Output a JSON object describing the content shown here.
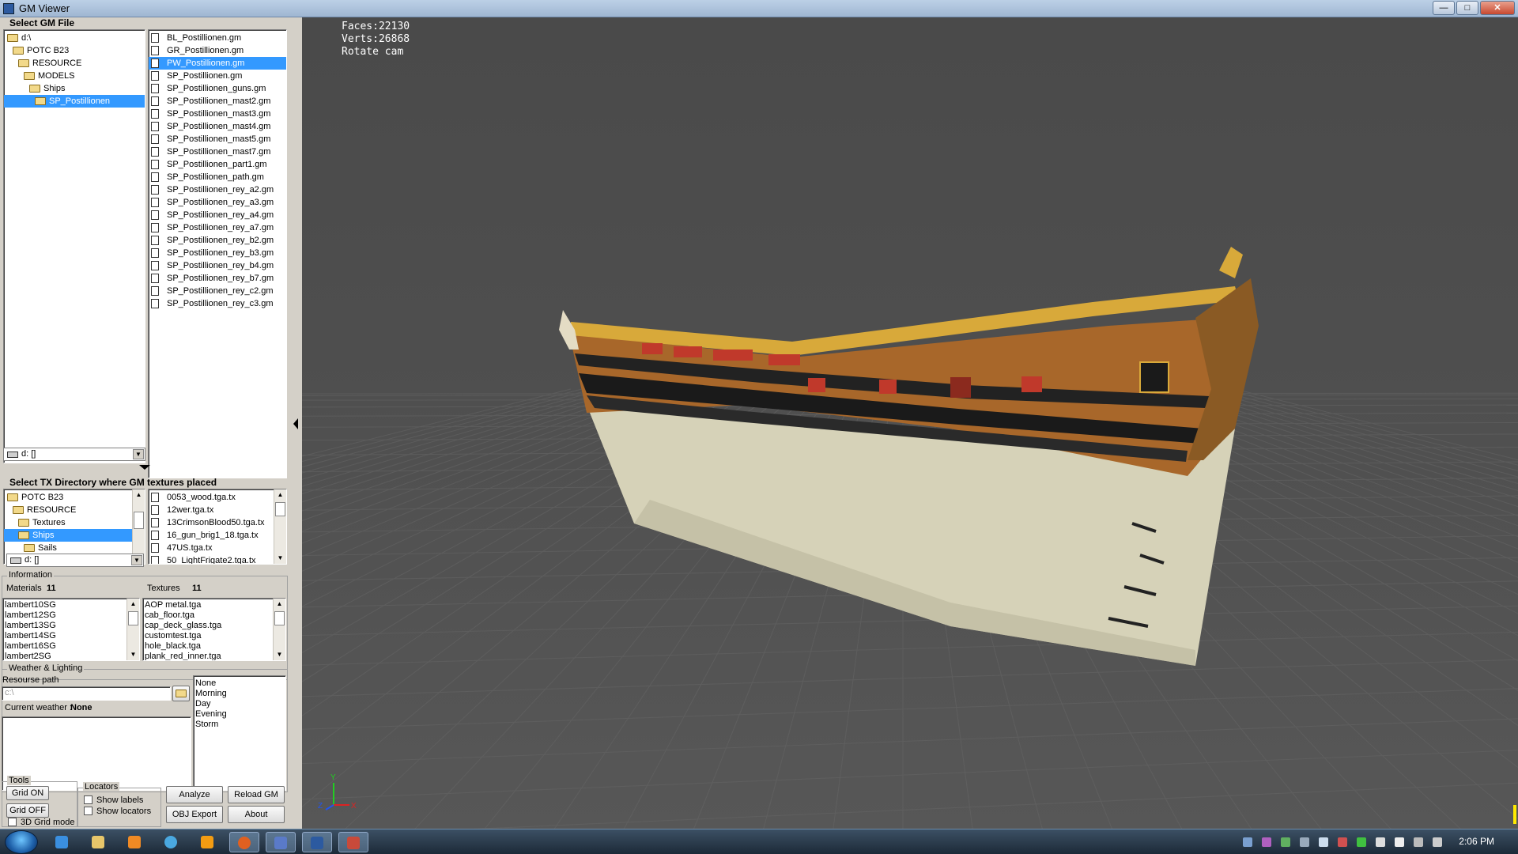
{
  "window": {
    "title": "GM Viewer"
  },
  "gm_file": {
    "group_title": "Select GM File",
    "tree": [
      {
        "label": "d:\\",
        "indent": 0,
        "selected": false
      },
      {
        "label": "POTC B23",
        "indent": 1,
        "selected": false
      },
      {
        "label": "RESOURCE",
        "indent": 2,
        "selected": false
      },
      {
        "label": "MODELS",
        "indent": 3,
        "selected": false
      },
      {
        "label": "Ships",
        "indent": 4,
        "selected": false
      },
      {
        "label": "SP_Postillionen",
        "indent": 5,
        "selected": true
      }
    ],
    "drive_combo": "d: []",
    "files": [
      "BL_Postillionen.gm",
      "GR_Postillionen.gm",
      "PW_Postillionen.gm",
      "SP_Postillionen.gm",
      "SP_Postillionen_guns.gm",
      "SP_Postillionen_mast2.gm",
      "SP_Postillionen_mast3.gm",
      "SP_Postillionen_mast4.gm",
      "SP_Postillionen_mast5.gm",
      "SP_Postillionen_mast7.gm",
      "SP_Postillionen_part1.gm",
      "SP_Postillionen_path.gm",
      "SP_Postillionen_rey_a2.gm",
      "SP_Postillionen_rey_a3.gm",
      "SP_Postillionen_rey_a4.gm",
      "SP_Postillionen_rey_a7.gm",
      "SP_Postillionen_rey_b2.gm",
      "SP_Postillionen_rey_b3.gm",
      "SP_Postillionen_rey_b4.gm",
      "SP_Postillionen_rey_b7.gm",
      "SP_Postillionen_rey_c2.gm",
      "SP_Postillionen_rey_c3.gm"
    ],
    "selected_file_index": 2
  },
  "tx_dir": {
    "group_title": "Select TX Directory where GM textures placed",
    "tree": [
      {
        "label": "POTC B23",
        "indent": 0,
        "selected": false
      },
      {
        "label": "RESOURCE",
        "indent": 1,
        "selected": false
      },
      {
        "label": "Textures",
        "indent": 2,
        "selected": false
      },
      {
        "label": "Ships",
        "indent": 2,
        "selected": true
      },
      {
        "label": "Sails",
        "indent": 3,
        "selected": false
      }
    ],
    "drive_combo": "d: []",
    "files": [
      "0053_wood.tga.tx",
      "12wer.tga.tx",
      "13CrimsonBlood50.tga.tx",
      "16_gun_brig1_18.tga.tx",
      "47US.tga.tx",
      "50_LightFrigate2.tga.tx"
    ]
  },
  "information": {
    "legend": "Information",
    "materials_label": "Materials",
    "materials_count": "11",
    "textures_label": "Textures",
    "textures_count": "11",
    "materials": [
      "lambert10SG",
      "lambert12SG",
      "lambert13SG",
      "lambert14SG",
      "lambert16SG",
      "lambert2SG"
    ],
    "textures": [
      "AOP metal.tga",
      "cab_floor.tga",
      "cap_deck_glass.tga",
      "customtest.tga",
      "hole_black.tga",
      "plank_red_inner.tga"
    ]
  },
  "weather": {
    "legend": "Weather & Lighting",
    "resource_path_label": "Resourse path",
    "resource_path_value": "c:\\",
    "current_weather_label": "Current weather :",
    "current_weather_value": "None",
    "options": [
      "None",
      "Morning",
      "Day",
      "Evening",
      "Storm"
    ]
  },
  "tools": {
    "legend": "Tools",
    "grid_on": "Grid ON",
    "grid_off": "Grid OFF",
    "grid_3d": "3D Grid mode",
    "locators_legend": "Locators",
    "show_labels": "Show labels",
    "show_locators": "Show locators",
    "analyze": "Analyze",
    "reload_gm": "Reload GM",
    "obj_export": "OBJ Export",
    "about": "About"
  },
  "viewport": {
    "faces": "Faces:22130",
    "verts": "Verts:26868",
    "mode": "Rotate cam",
    "axis_labels": {
      "x": "X",
      "y": "Y",
      "z": "Z"
    }
  },
  "taskbar": {
    "clock": "2:06 PM"
  },
  "colors": {
    "selection": "#3399ff",
    "hull_wood": "#a8672a",
    "hull_white": "#d6d2b8",
    "hull_black": "#1a1a1a",
    "trim_gold": "#d8a93a",
    "viewport_bg": "#4e4e4e"
  }
}
